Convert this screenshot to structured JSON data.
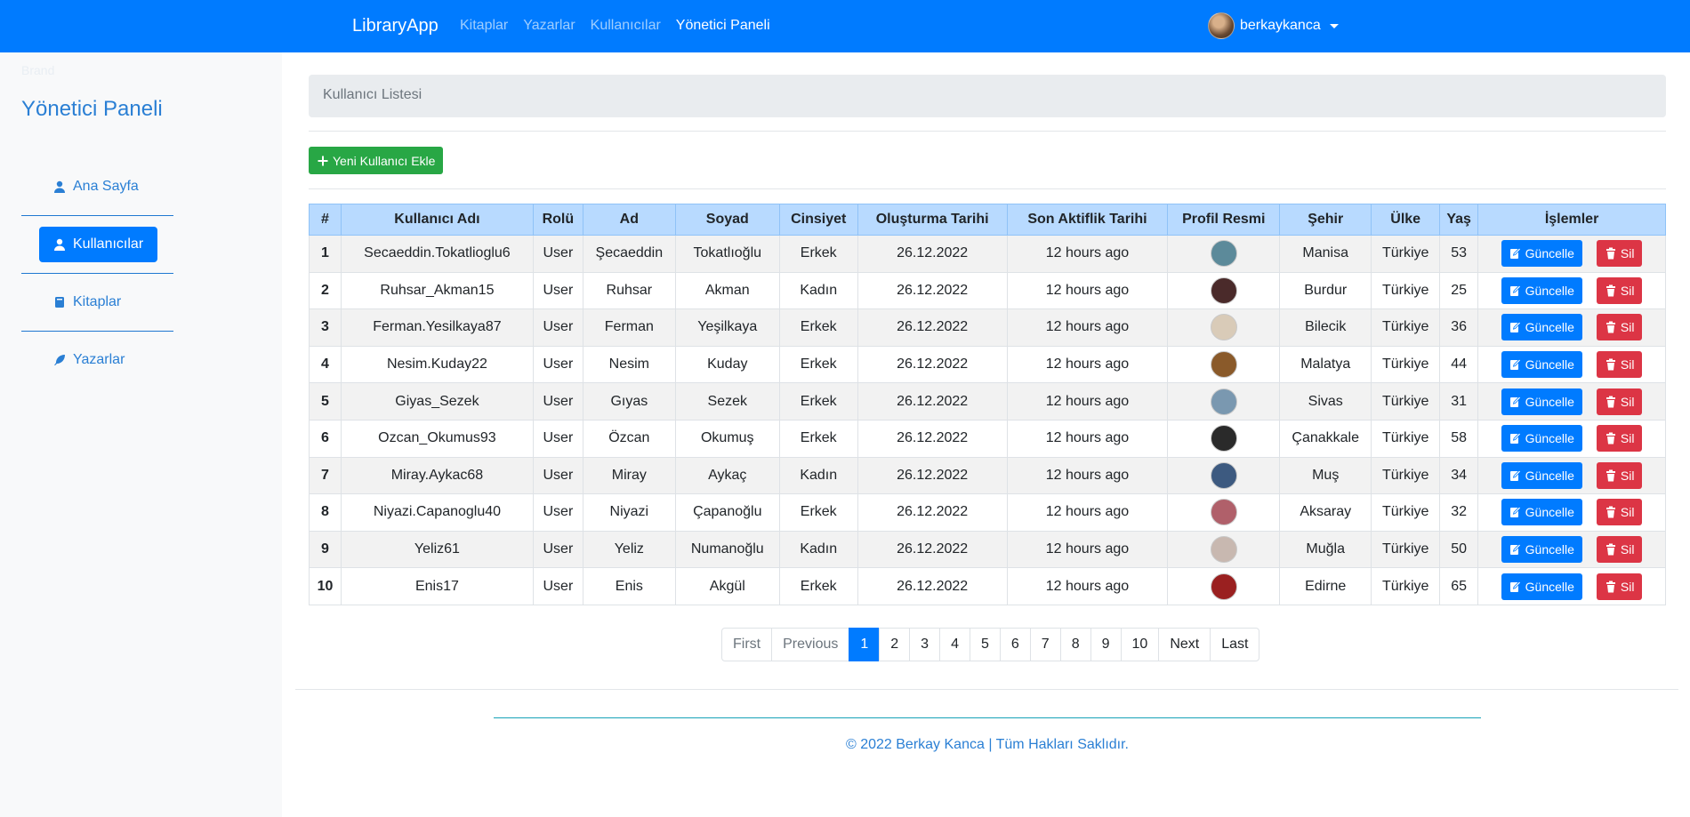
{
  "navbar": {
    "brand": "LibraryApp",
    "links": [
      "Kitaplar",
      "Yazarlar",
      "Kullanıcılar",
      "Yönetici Paneli"
    ],
    "active_link": "Yönetici Paneli",
    "username": "berkaykanca",
    "bg_color": "#007bff"
  },
  "sidebar": {
    "brand": "Brand",
    "title": "Yönetici Paneli",
    "items": [
      {
        "label": "Ana Sayfa",
        "icon": "user-icon"
      },
      {
        "label": "Kullanıcılar",
        "icon": "user-icon",
        "active": true
      },
      {
        "label": "Kitaplar",
        "icon": "book-icon"
      },
      {
        "label": "Yazarlar",
        "icon": "feather-icon"
      }
    ]
  },
  "breadcrumb": "Kullanıcı Listesi",
  "add_button": "Yeni Kullanıcı Ekle",
  "table": {
    "headers": [
      "#",
      "Kullanıcı Adı",
      "Rolü",
      "Ad",
      "Soyad",
      "Cinsiyet",
      "Oluşturma Tarihi",
      "Son Aktiflik Tarihi",
      "Profil Resmi",
      "Şehir",
      "Ülke",
      "Yaş",
      "İşlemler"
    ],
    "update_label": "Güncelle",
    "delete_label": "Sil",
    "rows": [
      [
        "1",
        "Secaeddin.Tokatlioglu6",
        "User",
        "Şecaeddin",
        "Tokatlıoğlu",
        "Erkek",
        "26.12.2022",
        "12 hours ago",
        "Manisa",
        "Türkiye",
        "53"
      ],
      [
        "2",
        "Ruhsar_Akman15",
        "User",
        "Ruhsar",
        "Akman",
        "Kadın",
        "26.12.2022",
        "12 hours ago",
        "Burdur",
        "Türkiye",
        "25"
      ],
      [
        "3",
        "Ferman.Yesilkaya87",
        "User",
        "Ferman",
        "Yeşilkaya",
        "Erkek",
        "26.12.2022",
        "12 hours ago",
        "Bilecik",
        "Türkiye",
        "36"
      ],
      [
        "4",
        "Nesim.Kuday22",
        "User",
        "Nesim",
        "Kuday",
        "Erkek",
        "26.12.2022",
        "12 hours ago",
        "Malatya",
        "Türkiye",
        "44"
      ],
      [
        "5",
        "Giyas_Sezek",
        "User",
        "Gıyas",
        "Sezek",
        "Erkek",
        "26.12.2022",
        "12 hours ago",
        "Sivas",
        "Türkiye",
        "31"
      ],
      [
        "6",
        "Ozcan_Okumus93",
        "User",
        "Özcan",
        "Okumuş",
        "Erkek",
        "26.12.2022",
        "12 hours ago",
        "Çanakkale",
        "Türkiye",
        "58"
      ],
      [
        "7",
        "Miray.Aykac68",
        "User",
        "Miray",
        "Aykaç",
        "Kadın",
        "26.12.2022",
        "12 hours ago",
        "Muş",
        "Türkiye",
        "34"
      ],
      [
        "8",
        "Niyazi.Capanoglu40",
        "User",
        "Niyazi",
        "Çapanoğlu",
        "Erkek",
        "26.12.2022",
        "12 hours ago",
        "Aksaray",
        "Türkiye",
        "32"
      ],
      [
        "9",
        "Yeliz61",
        "User",
        "Yeliz",
        "Numanoğlu",
        "Kadın",
        "26.12.2022",
        "12 hours ago",
        "Muğla",
        "Türkiye",
        "50"
      ],
      [
        "10",
        "Enis17",
        "User",
        "Enis",
        "Akgül",
        "Erkek",
        "26.12.2022",
        "12 hours ago",
        "Edirne",
        "Türkiye",
        "65"
      ]
    ],
    "thumb_colors": [
      "#5c8a9a",
      "#4a2a2a",
      "#d9cbb8",
      "#8a5a2a",
      "#7a98b0",
      "#2a2a2a",
      "#3d5a80",
      "#b0606a",
      "#c8b8b0",
      "#9a2020"
    ]
  },
  "pagination": {
    "first": "First",
    "previous": "Previous",
    "pages": [
      "1",
      "2",
      "3",
      "4",
      "5",
      "6",
      "7",
      "8",
      "9",
      "10"
    ],
    "active_page": "1",
    "next": "Next",
    "last": "Last"
  },
  "footer": "© 2022 Berkay Kanca | Tüm Hakları Saklıdır."
}
